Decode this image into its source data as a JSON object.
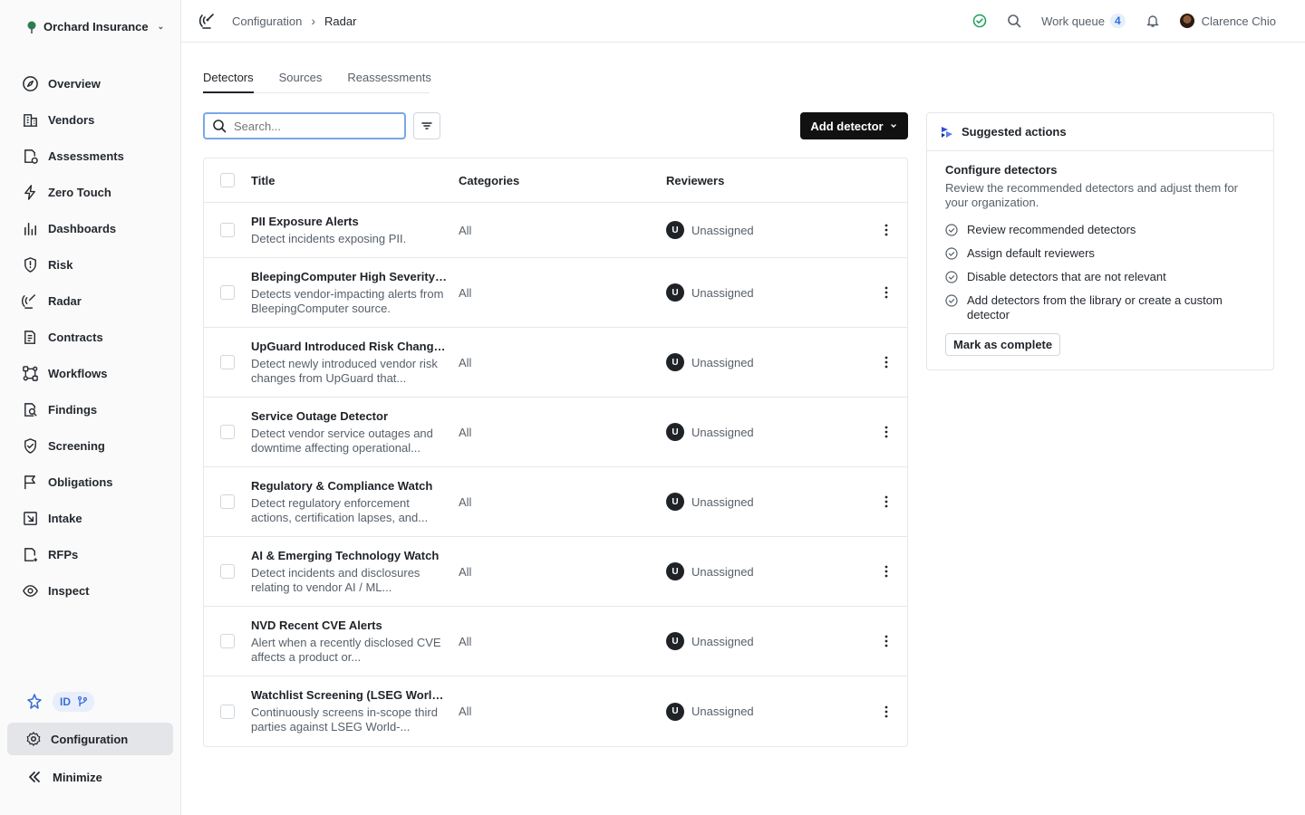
{
  "sidebar": {
    "org_name": "Orchard Insurance",
    "items": [
      {
        "label": "Overview",
        "icon": "compass-icon"
      },
      {
        "label": "Vendors",
        "icon": "building-icon"
      },
      {
        "label": "Assessments",
        "icon": "document-check-icon"
      },
      {
        "label": "Zero Touch",
        "icon": "lightning-icon"
      },
      {
        "label": "Dashboards",
        "icon": "bar-chart-icon"
      },
      {
        "label": "Risk",
        "icon": "shield-alert-icon"
      },
      {
        "label": "Radar",
        "icon": "radar-icon"
      },
      {
        "label": "Contracts",
        "icon": "contract-icon"
      },
      {
        "label": "Workflows",
        "icon": "workflow-icon"
      },
      {
        "label": "Findings",
        "icon": "findings-icon"
      },
      {
        "label": "Screening",
        "icon": "shield-check-icon"
      },
      {
        "label": "Obligations",
        "icon": "flag-icon"
      },
      {
        "label": "Intake",
        "icon": "intake-icon"
      },
      {
        "label": "RFPs",
        "icon": "rfp-icon"
      },
      {
        "label": "Inspect",
        "icon": "eye-icon"
      }
    ],
    "id_label": "ID",
    "configuration_label": "Configuration",
    "minimize_label": "Minimize"
  },
  "topbar": {
    "breadcrumb_parent": "Configuration",
    "breadcrumb_current": "Radar",
    "work_queue_label": "Work queue",
    "work_queue_count": "4",
    "user_name": "Clarence Chio"
  },
  "tabs": [
    "Detectors",
    "Sources",
    "Reassessments"
  ],
  "search": {
    "placeholder": "Search..."
  },
  "add_detector_label": "Add detector",
  "table": {
    "headers": {
      "title": "Title",
      "categories": "Categories",
      "reviewers": "Reviewers"
    },
    "rows": [
      {
        "title": "PII Exposure Alerts",
        "desc": "Detect incidents exposing PII.",
        "category": "All",
        "reviewer": "Unassigned",
        "initial": "U"
      },
      {
        "title": "BleepingComputer High Severity ...",
        "desc": "Detects vendor-impacting alerts from BleepingComputer source.",
        "category": "All",
        "reviewer": "Unassigned",
        "initial": "U"
      },
      {
        "title": "UpGuard Introduced Risk Change...",
        "desc": "Detect newly introduced vendor risk changes from UpGuard that...",
        "category": "All",
        "reviewer": "Unassigned",
        "initial": "U"
      },
      {
        "title": "Service Outage Detector",
        "desc": "Detect vendor service outages and downtime affecting operational...",
        "category": "All",
        "reviewer": "Unassigned",
        "initial": "U"
      },
      {
        "title": "Regulatory & Compliance Watch",
        "desc": "Detect regulatory enforcement actions, certification lapses, and...",
        "category": "All",
        "reviewer": "Unassigned",
        "initial": "U"
      },
      {
        "title": "AI & Emerging Technology Watch",
        "desc": "Detect incidents and disclosures relating to vendor AI / ML...",
        "category": "All",
        "reviewer": "Unassigned",
        "initial": "U"
      },
      {
        "title": "NVD Recent CVE Alerts",
        "desc": "Alert when a recently disclosed CVE affects a product or...",
        "category": "All",
        "reviewer": "Unassigned",
        "initial": "U"
      },
      {
        "title": "Watchlist Screening (LSEG World...",
        "desc": "Continuously screens in-scope third parties against LSEG World-...",
        "category": "All",
        "reviewer": "Unassigned",
        "initial": "U"
      }
    ]
  },
  "suggested": {
    "header": "Suggested actions",
    "title": "Configure detectors",
    "desc": "Review the recommended detectors and adjust them for your organization.",
    "items": [
      "Review recommended detectors",
      "Assign default reviewers",
      "Disable detectors that are not relevant",
      "Add detectors from the library or create a custom detector"
    ],
    "button": "Mark as complete"
  },
  "colors": {
    "accent": "#2f6fd6",
    "success": "#1a9e5a",
    "dark_button": "#111111"
  }
}
